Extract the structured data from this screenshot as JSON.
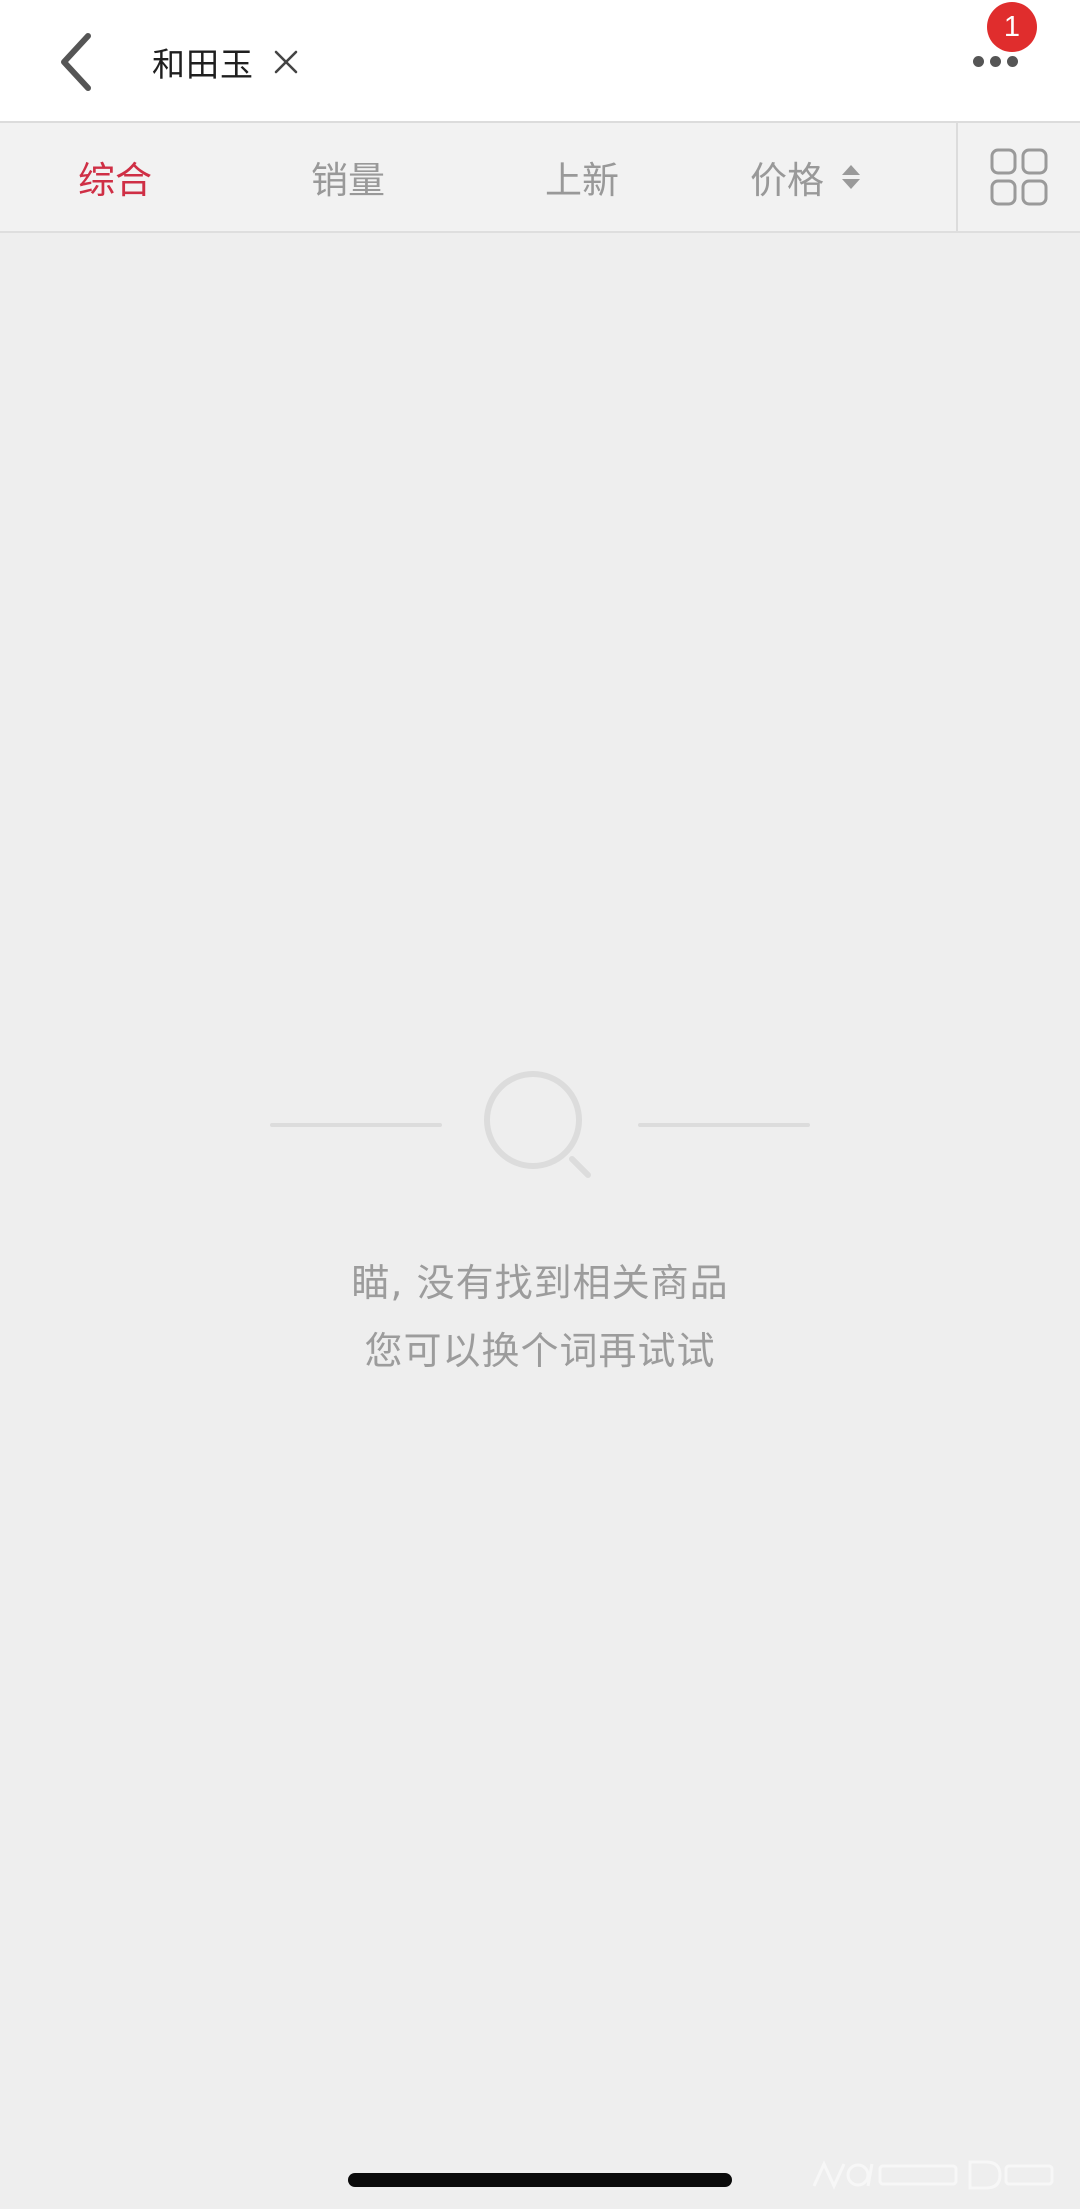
{
  "header": {
    "back_icon": "chevron-left-icon",
    "query": "和田玉",
    "clear_icon": "close-icon",
    "more_icon": "more-dots-icon",
    "notification_count": "1"
  },
  "sort_bar": {
    "tabs": [
      {
        "label": "综合",
        "active": true
      },
      {
        "label": "销量",
        "active": false
      },
      {
        "label": "上新",
        "active": false
      },
      {
        "label": "价格",
        "active": false
      }
    ],
    "price_sort_icon": "sort-arrows-icon",
    "layout_toggle_icon": "grid-view-icon"
  },
  "empty_state": {
    "icon": "search-icon",
    "line1": "瞄, 没有找到相关商品",
    "line2": "您可以换个词再试试"
  },
  "colors": {
    "accent": "#cf2f45",
    "badge": "#e02d2d",
    "background": "#eeeeee",
    "muted_text": "#9c9c9c"
  }
}
